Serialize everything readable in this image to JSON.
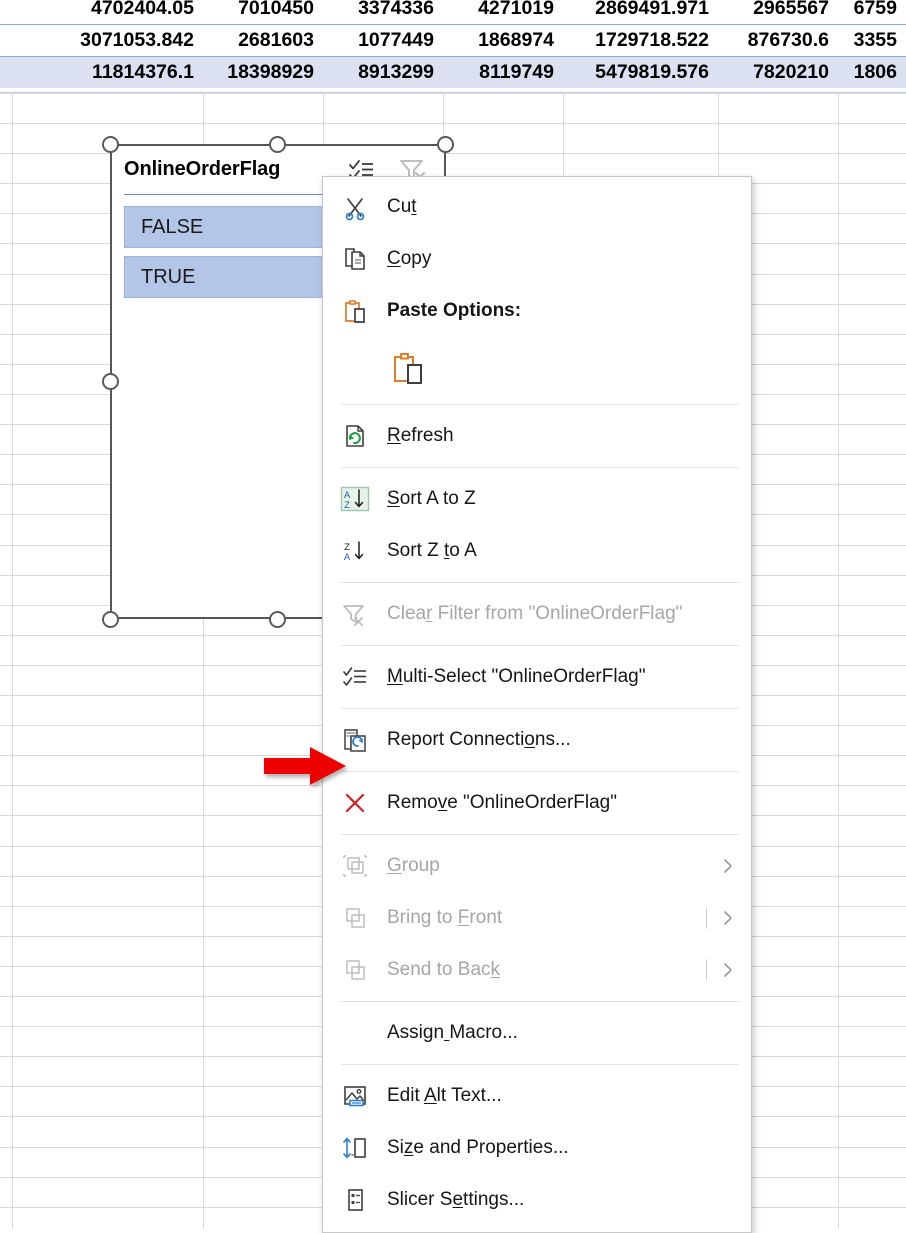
{
  "spreadsheet": {
    "rows": [
      {
        "highlighted": false,
        "cells": [
          "4702404.05",
          "7010450",
          "3374336",
          "4271019",
          "2869491.971",
          "2965567",
          "6759"
        ]
      },
      {
        "highlighted": false,
        "cells": [
          "3071053.842",
          "2681603",
          "1077449",
          "1868974",
          "1729718.522",
          "876730.6",
          "3355"
        ]
      },
      {
        "highlighted": true,
        "cells": [
          "11814376.1",
          "18398929",
          "8913299",
          "8119749",
          "5479819.576",
          "7820210",
          "1806"
        ]
      }
    ],
    "colors": {
      "row_highlight": "#dce1f2",
      "row_separator": "#8ea9db",
      "gridline": "#d9d9d9"
    }
  },
  "slicer": {
    "title": "OnlineOrderFlag",
    "header_buttons": [
      {
        "name": "multi-select-icon",
        "enabled": true
      },
      {
        "name": "clear-filter-icon",
        "enabled": false
      }
    ],
    "items": [
      {
        "label": "FALSE",
        "selected": true
      },
      {
        "label": "TRUE",
        "selected": true
      }
    ],
    "selected": true,
    "colors": {
      "item_fill": "#b4c6e7",
      "frame": "#565656",
      "divider": "#6e8cc4"
    }
  },
  "context_menu": {
    "items": [
      {
        "id": "cut",
        "label": "Cut",
        "accel_index": 2,
        "icon": "scissors-icon",
        "enabled": true,
        "bold": false,
        "submenu": false
      },
      {
        "id": "copy",
        "label": "Copy",
        "accel_index": 0,
        "icon": "copy-icon",
        "enabled": true,
        "bold": false,
        "submenu": false
      },
      {
        "id": "paste-options",
        "label": "Paste Options:",
        "accel_index": -1,
        "icon": "paste-icon",
        "enabled": true,
        "bold": true,
        "submenu": false
      },
      {
        "id": "paste-gallery",
        "label": "",
        "accel_index": -1,
        "icon": "paste-keep-source-formatting-icon",
        "enabled": true,
        "bold": false,
        "submenu": false,
        "gallery": true
      },
      {
        "id": "sep-1",
        "separator": true
      },
      {
        "id": "refresh",
        "label": "Refresh",
        "accel_index": 0,
        "icon": "refresh-icon",
        "enabled": true,
        "bold": false,
        "submenu": false
      },
      {
        "id": "sep-2",
        "separator": true
      },
      {
        "id": "sort-a-z",
        "label": "Sort A to Z",
        "accel_index": 0,
        "icon": "sort-ascending-icon",
        "enabled": true,
        "bold": false,
        "submenu": false
      },
      {
        "id": "sort-z-a",
        "label": "Sort Z to A",
        "accel_index": 7,
        "icon": "sort-descending-icon",
        "enabled": true,
        "bold": false,
        "submenu": false
      },
      {
        "id": "sep-3",
        "separator": true
      },
      {
        "id": "clear-filter",
        "label": "Clear Filter from \"OnlineOrderFlag\"",
        "accel_index": 4,
        "icon": "clear-filter-icon",
        "enabled": false,
        "bold": false,
        "submenu": false
      },
      {
        "id": "sep-4",
        "separator": true
      },
      {
        "id": "multi-select",
        "label": "Multi-Select \"OnlineOrderFlag\"",
        "accel_index": 0,
        "icon": "multi-select-icon",
        "enabled": true,
        "bold": false,
        "submenu": false
      },
      {
        "id": "sep-5",
        "separator": true
      },
      {
        "id": "report-connections",
        "label": "Report Connections...",
        "accel_index": 15,
        "icon": "report-connections-icon",
        "enabled": true,
        "bold": false,
        "submenu": false
      },
      {
        "id": "sep-6",
        "separator": true
      },
      {
        "id": "remove",
        "label": "Remove \"OnlineOrderFlag\"",
        "accel_index": 4,
        "icon": "remove-x-icon",
        "enabled": true,
        "bold": false,
        "submenu": false
      },
      {
        "id": "sep-7",
        "separator": true
      },
      {
        "id": "group",
        "label": "Group",
        "accel_index": 0,
        "icon": "group-icon",
        "enabled": false,
        "bold": false,
        "submenu": true,
        "submenu_bar": false
      },
      {
        "id": "bring-to-front",
        "label": "Bring to Front",
        "accel_index": 9,
        "icon": "bring-to-front-icon",
        "enabled": false,
        "bold": false,
        "submenu": true,
        "submenu_bar": true
      },
      {
        "id": "send-to-back",
        "label": "Send to Back",
        "accel_index": 11,
        "icon": "send-to-back-icon",
        "enabled": false,
        "bold": false,
        "submenu": true,
        "submenu_bar": true
      },
      {
        "id": "sep-8",
        "separator": true
      },
      {
        "id": "assign-macro",
        "label": "Assign Macro...",
        "accel_index": 6,
        "icon": "",
        "enabled": true,
        "bold": false,
        "submenu": false
      },
      {
        "id": "sep-9",
        "separator": true
      },
      {
        "id": "edit-alt-text",
        "label": "Edit Alt Text...",
        "accel_index": 5,
        "icon": "alt-text-icon",
        "enabled": true,
        "bold": false,
        "submenu": false
      },
      {
        "id": "size-and-properties",
        "label": "Size and Properties...",
        "accel_index": 2,
        "icon": "size-properties-icon",
        "enabled": true,
        "bold": false,
        "submenu": false
      },
      {
        "id": "slicer-settings",
        "label": "Slicer Settings...",
        "accel_index": 8,
        "icon": "slicer-settings-icon",
        "enabled": true,
        "bold": false,
        "submenu": false
      }
    ]
  },
  "annotation": {
    "arrow": {
      "name": "red-arrow-pointer",
      "color": "#ee0000",
      "points_to": "remove"
    }
  }
}
